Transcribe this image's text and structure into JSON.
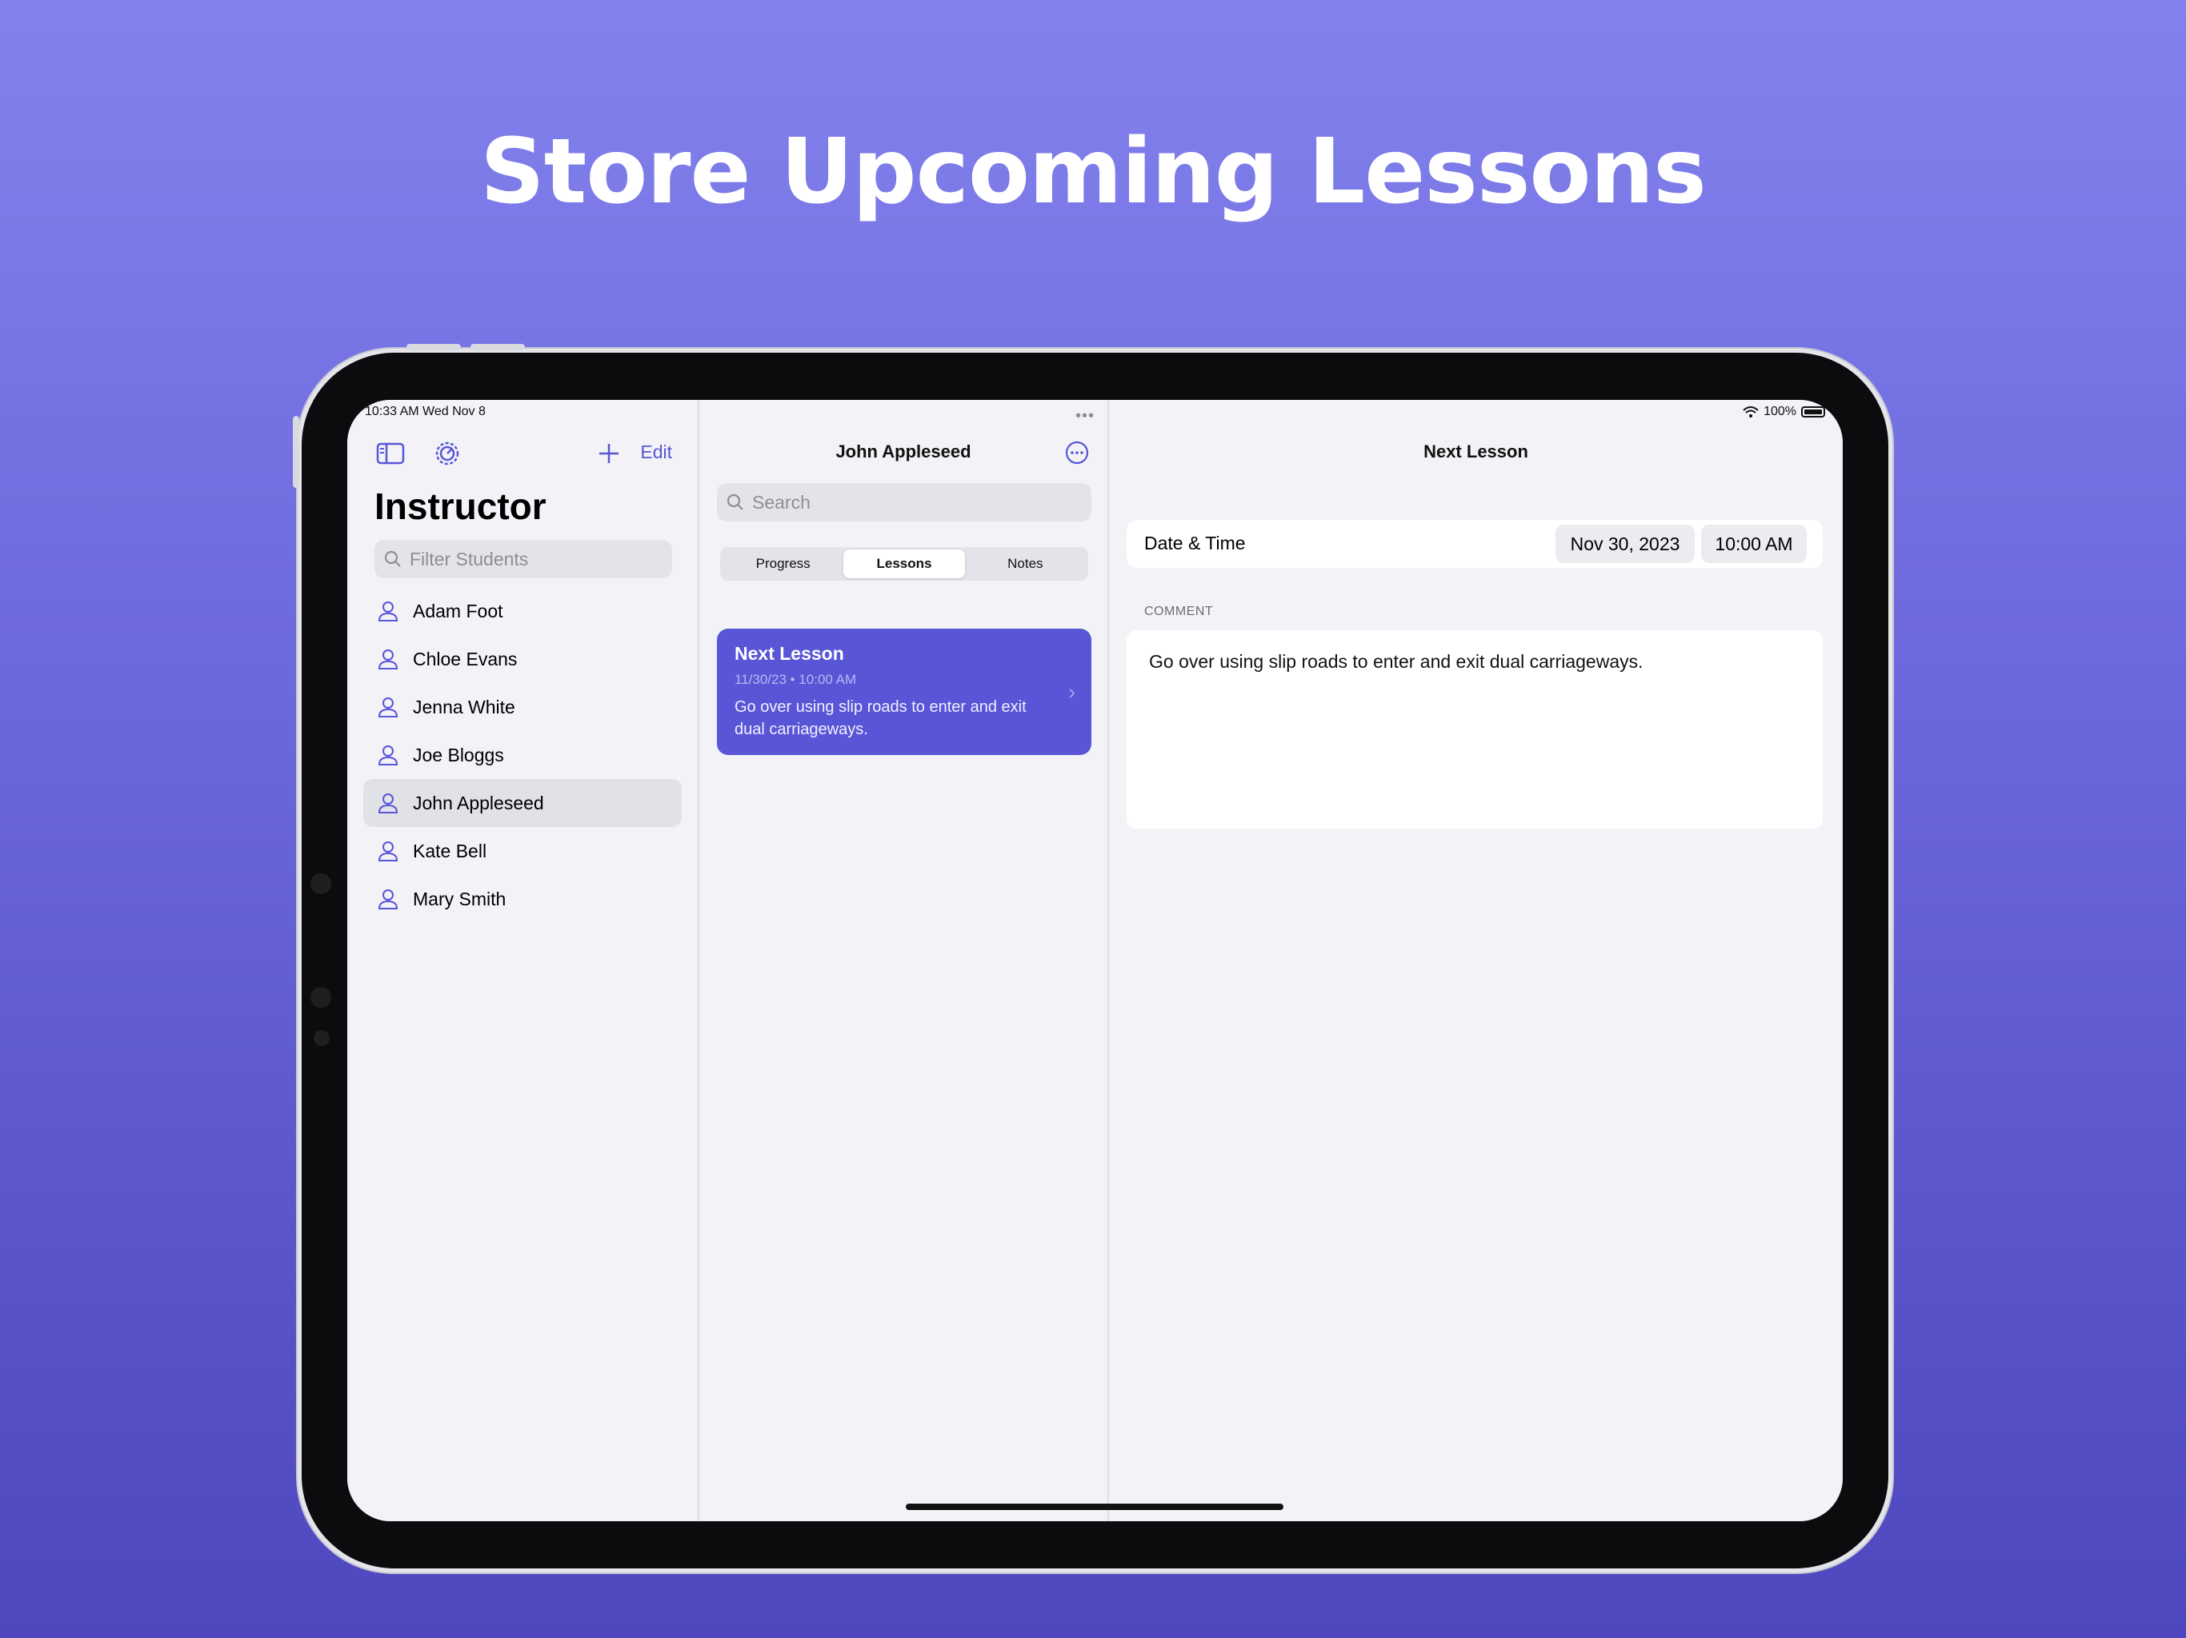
{
  "headline": "Store Upcoming Lessons",
  "status_bar": {
    "time_date": "10:33 AM   Wed Nov 8",
    "battery": "100%"
  },
  "sidebar": {
    "title": "Instructor",
    "edit_label": "Edit",
    "filter_placeholder": "Filter Students",
    "students": [
      {
        "name": "Adam Foot",
        "selected": false
      },
      {
        "name": "Chloe Evans",
        "selected": false
      },
      {
        "name": "Jenna White",
        "selected": false
      },
      {
        "name": "Joe Bloggs",
        "selected": false
      },
      {
        "name": "John Appleseed",
        "selected": true
      },
      {
        "name": "Kate Bell",
        "selected": false
      },
      {
        "name": "Mary Smith",
        "selected": false
      }
    ]
  },
  "middle": {
    "title": "John Appleseed",
    "search_placeholder": "Search",
    "segments": [
      "Progress",
      "Lessons",
      "Notes"
    ],
    "active_segment": "Lessons",
    "lesson_card": {
      "title": "Next Lesson",
      "date": "11/30/23 • 10:00 AM",
      "body": "Go over using slip roads to enter and exit dual carriageways."
    }
  },
  "detail": {
    "title": "Next Lesson",
    "datetime_label": "Date & Time",
    "date_value": "Nov 30, 2023",
    "time_value": "10:00 AM",
    "comment_label": "COMMENT",
    "comment_text": "Go over using slip roads to enter and exit dual carriageways."
  },
  "colors": {
    "accent": "#5856d6",
    "background_top": "#8282ec",
    "background_bottom": "#4e47bd"
  }
}
